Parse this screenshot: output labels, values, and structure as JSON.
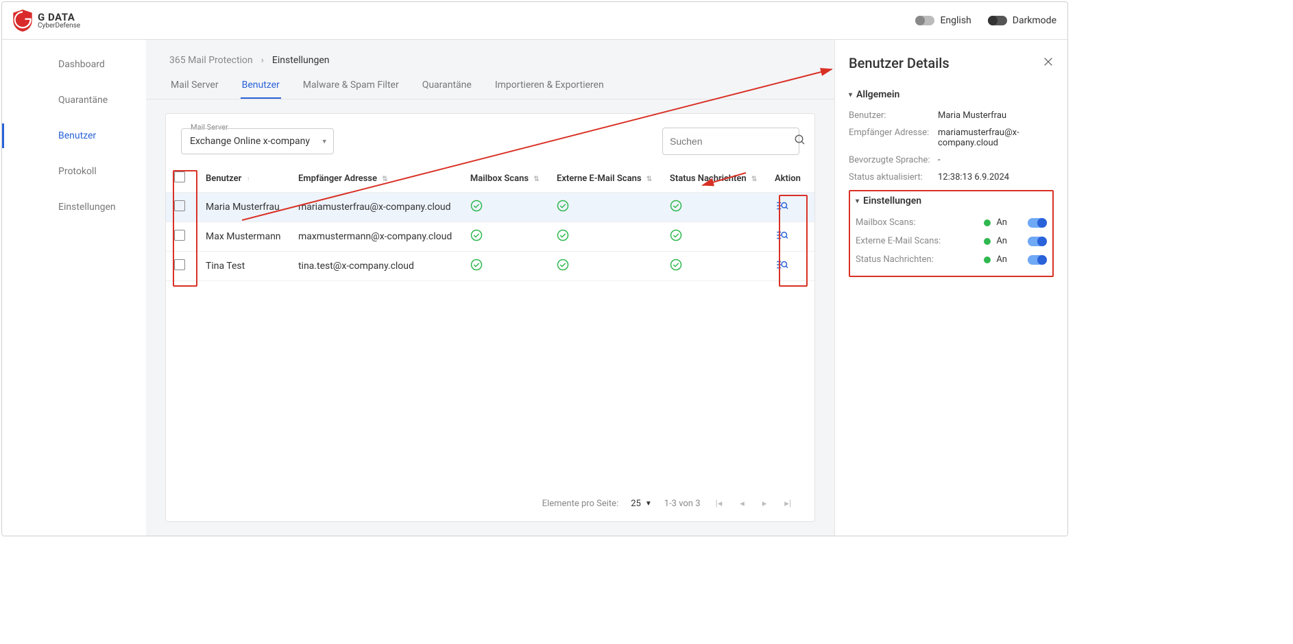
{
  "header": {
    "brand_main": "G DATA",
    "brand_sub": "CyberDefense",
    "lang_label": "English",
    "dark_label": "Darkmode"
  },
  "sidebar": {
    "items": [
      {
        "label": "Dashboard"
      },
      {
        "label": "Quarantäne"
      },
      {
        "label": "Benutzer"
      },
      {
        "label": "Protokoll"
      },
      {
        "label": "Einstellungen"
      }
    ],
    "active_index": 2
  },
  "breadcrumb": {
    "parent": "365 Mail Protection",
    "current": "Einstellungen"
  },
  "tabs": [
    {
      "label": "Mail Server"
    },
    {
      "label": "Benutzer"
    },
    {
      "label": "Malware & Spam Filter"
    },
    {
      "label": "Quarantäne"
    },
    {
      "label": "Importieren & Exportieren"
    }
  ],
  "tabs_active": 1,
  "mail_server_label": "Mail Server",
  "mail_server_value": "Exchange Online x-company",
  "search_placeholder": "Suchen",
  "columns": {
    "user": "Benutzer",
    "recipient": "Empfänger Adresse",
    "mailbox": "Mailbox Scans",
    "external": "Externe E-Mail Scans",
    "status": "Status Nachrichten",
    "action": "Aktion"
  },
  "rows": [
    {
      "user": "Maria Musterfrau",
      "email": "mariamusterfrau@x-company.cloud",
      "selected": true
    },
    {
      "user": "Max Mustermann",
      "email": "maxmustermann@x-company.cloud",
      "selected": false
    },
    {
      "user": "Tina Test",
      "email": "tina.test@x-company.cloud",
      "selected": false
    }
  ],
  "pager": {
    "per_page_label": "Elemente pro Seite:",
    "per_page_value": "25",
    "range": "1-3 von 3"
  },
  "details": {
    "title": "Benutzer Details",
    "general_head": "Allgemein",
    "fields": {
      "user_label": "Benutzer:",
      "user_value": "Maria Musterfrau",
      "recipient_label": "Empfänger Adresse:",
      "recipient_value": "mariamusterfrau@x-company.cloud",
      "lang_label": "Bevorzugte Sprache:",
      "lang_value": "-",
      "updated_label": "Status aktualisiert:",
      "updated_value": "12:38:13 6.9.2024"
    },
    "settings_head": "Einstellungen",
    "settings": [
      {
        "label": "Mailbox Scans:",
        "value": "An"
      },
      {
        "label": "Externe E-Mail Scans:",
        "value": "An"
      },
      {
        "label": "Status Nachrichten:",
        "value": "An"
      }
    ]
  }
}
